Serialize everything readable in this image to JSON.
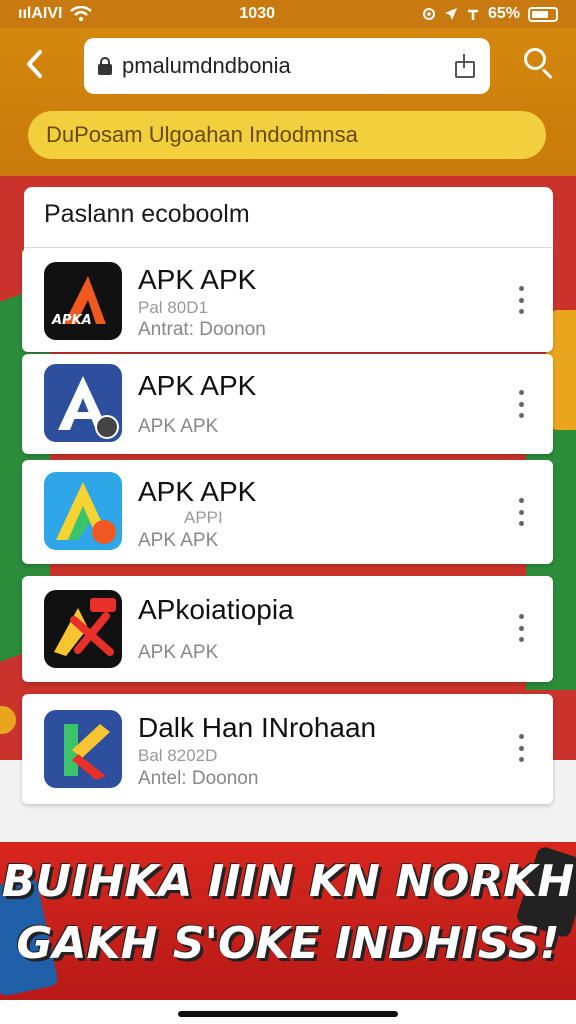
{
  "status_bar": {
    "carrier": "ıılAIVI",
    "time": "1030",
    "battery": "65%"
  },
  "header": {
    "url": "pmalumdndbonia",
    "banner_text": "DuPosam Ulgoahan Indodmnsa"
  },
  "list": {
    "title": "Paslann ecoboolm",
    "items": [
      {
        "title": "APK APK",
        "line1": "Pal 80D1",
        "line2": "Antrat: Doonon",
        "icon": "apk-a-black-icon"
      },
      {
        "title": "APK APK",
        "line1": "APK APK",
        "line2": "",
        "icon": "apk-a-blue-icon"
      },
      {
        "title": "APK APK",
        "line1": "APPI",
        "line2": "APK APK",
        "icon": "apk-a-colorful-icon"
      },
      {
        "title": "APkoiatiopia",
        "line1": "APK APK",
        "line2": "",
        "icon": "apk-x-icon"
      },
      {
        "title": "Dalk Han INrohaan",
        "line1": "Bal 8202D",
        "line2": "Antel: Doonon",
        "icon": "apk-k-icon"
      }
    ]
  },
  "ad": {
    "line1": "BUIHKA IIIN KN NORKH",
    "line2": "GAKH S'OKE INDHISS!"
  },
  "colors": {
    "header_orange": "#d4880e",
    "banner_yellow": "#f2cf3d",
    "ad_red": "#d7261e"
  }
}
